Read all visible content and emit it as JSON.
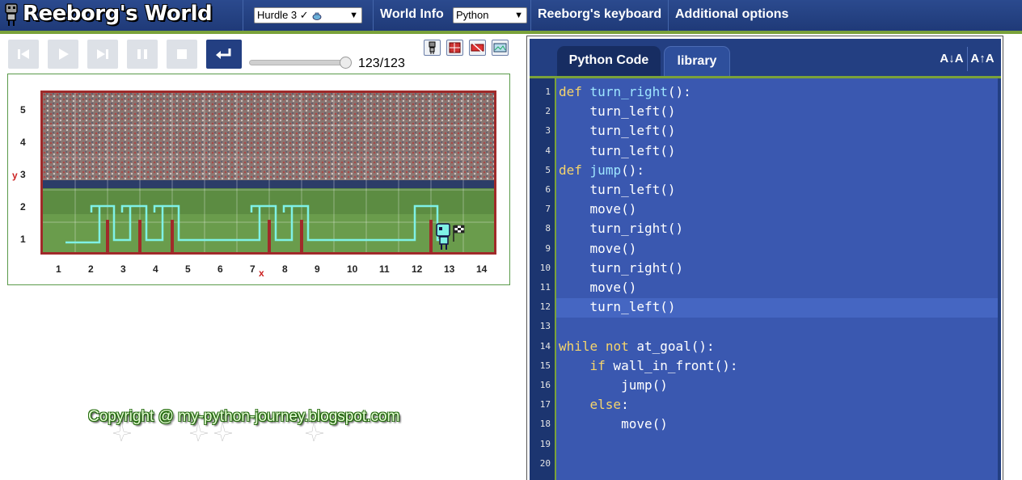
{
  "header": {
    "title": "Reeborg's World",
    "world_select": "Hurdle 3 ✓",
    "world_info": "World Info",
    "language_select": "Python",
    "keyboard": "Reeborg's keyboard",
    "additional_options": "Additional options"
  },
  "controls": {
    "steps": "123/123",
    "slider_progress": 1.0,
    "buttons": [
      "reload-icon",
      "play-icon",
      "step-icon",
      "pause-icon",
      "stop-icon",
      "return-icon"
    ],
    "small_buttons": [
      "robot-icon",
      "world-icon",
      "edit-world-icon",
      "gallery-icon"
    ]
  },
  "world": {
    "y_label": "y",
    "x_label": "x",
    "y_ticks": [
      "5",
      "4",
      "3",
      "2",
      "1"
    ],
    "x_ticks": [
      "1",
      "2",
      "3",
      "4",
      "5",
      "6",
      "7",
      "8",
      "9",
      "10",
      "11",
      "12",
      "13",
      "14"
    ],
    "border_color": "#a02a2a"
  },
  "copyright": "Copyright @ my-python-journey.blogspot.com",
  "editor": {
    "tabs": [
      "Python Code",
      "library"
    ],
    "font_decrease": "A↓A",
    "font_increase": "A↑A",
    "active_line": 12,
    "line_numbers": [
      "1",
      "2",
      "3",
      "4",
      "5",
      "6",
      "7",
      "8",
      "9",
      "10",
      "11",
      "12",
      "13",
      "14",
      "15",
      "16",
      "17",
      "18",
      "19",
      "20"
    ],
    "lines": [
      "def turn_right():",
      "    turn_left()",
      "    turn_left()",
      "    turn_left()",
      "def jump():",
      "    turn_left()",
      "    move()",
      "    turn_right()",
      "    move()",
      "    turn_right()",
      "    move()",
      "    turn_left()",
      "",
      "while not at_goal():",
      "    if wall_in_front():",
      "        jump()",
      "    else:",
      "        move()",
      "",
      ""
    ]
  },
  "colors": {
    "accent": "#233f82",
    "green_line": "#7aa23a",
    "code_bg": "#3a58b0",
    "keyword": "#f5d46c",
    "function": "#9fe6ff"
  }
}
